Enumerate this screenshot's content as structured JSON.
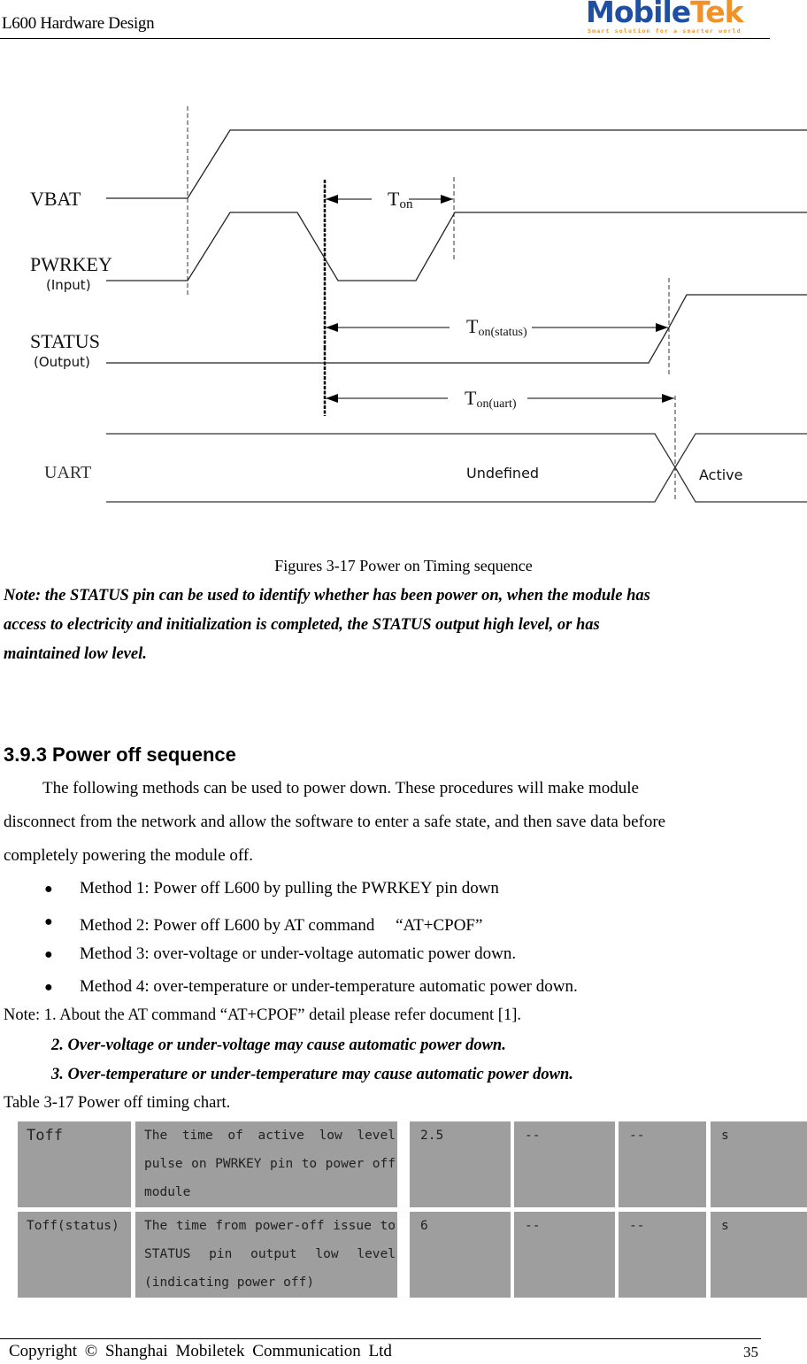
{
  "header": {
    "title": "L600 Hardware Design",
    "logo": {
      "text_blue": "Mobile",
      "text_orange": "Tek",
      "tagline": "Smart solution for a smarter world",
      "colors": {
        "blue": "#1f4fa3",
        "orange": "#f0922a"
      }
    }
  },
  "figure": {
    "signals": [
      {
        "name": "VBAT",
        "sub": ""
      },
      {
        "name": "PWRKEY",
        "sub": "(Input)"
      },
      {
        "name": "STATUS",
        "sub": "(Output)"
      },
      {
        "name": "UART",
        "sub": ""
      }
    ],
    "timing_labels": {
      "ton_main": "T",
      "ton_sub": "on",
      "ton_status_sub": "on(status)",
      "ton_uart_sub": "on(uart)"
    },
    "uart_states": {
      "before": "Undefined",
      "after": "Active"
    },
    "caption": "Figures 3-17 Power on Timing sequence"
  },
  "note_power_on": {
    "lines": [
      "Note: the STATUS pin can be used to identify whether has been power on, when the module has",
      "access to electricity and initialization is completed, the STATUS output high level, or has",
      "maintained low level."
    ]
  },
  "section": {
    "heading": "3.9.3 Power off sequence",
    "paragraph_lines": [
      "The following methods can be used to power down. These procedures will make module",
      "disconnect from the network and allow the software to enter a safe state, and then save data before",
      "completely powering the module off."
    ],
    "bullet_glyph": "●",
    "methods": [
      "Method 1: Power off L600 by pulling the PWRKEY pin down",
      "Method 2: Power off L600 by AT command 　“AT+CPOF”",
      "Method 3: over-voltage or under-voltage automatic power down.",
      "Method 4: over-temperature or under-temperature automatic power down."
    ],
    "notes": [
      "Note: 1. About the AT command “AT+CPOF” detail please refer document [1].",
      "2. Over-voltage or under-voltage may cause automatic power down.",
      "3. Over-temperature or under-temperature may cause automatic power down."
    ],
    "table_caption": "Table 3-17 Power off timing chart."
  },
  "table": {
    "rows": [
      {
        "symbol": "Toff",
        "description": "The time of active low level pulse on PWRKEY pin to power off module",
        "min": "2.5",
        "typ": "--",
        "max": "--",
        "unit": "s"
      },
      {
        "symbol": "Toff(status)",
        "description": "The time from power-off issue to STATUS pin output low level (indicating power off)",
        "min": "6",
        "typ": "--",
        "max": "--",
        "unit": "s"
      }
    ],
    "cell_color": "#9e9e9e"
  },
  "footer": {
    "copyright": "Copyright © Shanghai Mobiletek Communication Ltd",
    "page_number": "35"
  }
}
